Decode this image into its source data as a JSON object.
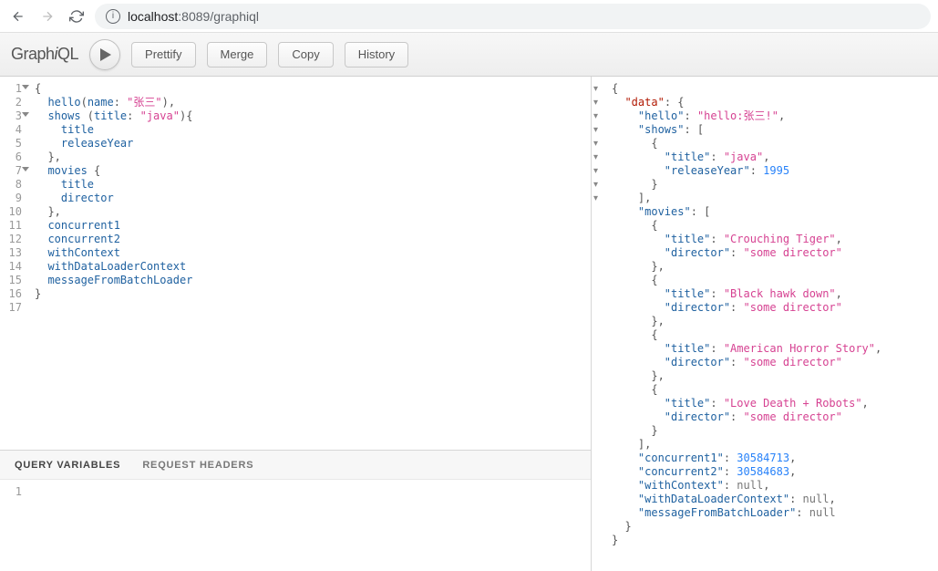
{
  "browser": {
    "url_host": "localhost",
    "url_port": ":8089",
    "url_path": "/graphiql"
  },
  "toolbar": {
    "logo_plain1": "Graph",
    "logo_italic": "i",
    "logo_plain2": "QL",
    "prettify": "Prettify",
    "merge": "Merge",
    "copy": "Copy",
    "history": "History"
  },
  "query_lines": [
    {
      "n": "1",
      "fold": true,
      "tokens": [
        {
          "t": "{",
          "c": "punc"
        }
      ]
    },
    {
      "n": "2",
      "tokens": [
        {
          "t": "  ",
          "c": ""
        },
        {
          "t": "hello",
          "c": "def"
        },
        {
          "t": "(",
          "c": "punc"
        },
        {
          "t": "name",
          "c": "attr"
        },
        {
          "t": ": ",
          "c": "punc"
        },
        {
          "t": "\"张三\"",
          "c": "str"
        },
        {
          "t": "),",
          "c": "punc"
        }
      ]
    },
    {
      "n": "3",
      "fold": true,
      "tokens": [
        {
          "t": "  ",
          "c": ""
        },
        {
          "t": "shows",
          "c": "def"
        },
        {
          "t": " (",
          "c": "punc"
        },
        {
          "t": "title",
          "c": "attr"
        },
        {
          "t": ": ",
          "c": "punc"
        },
        {
          "t": "\"java\"",
          "c": "str"
        },
        {
          "t": "){",
          "c": "punc"
        }
      ]
    },
    {
      "n": "4",
      "tokens": [
        {
          "t": "    ",
          "c": ""
        },
        {
          "t": "title",
          "c": "attr"
        }
      ]
    },
    {
      "n": "5",
      "tokens": [
        {
          "t": "    ",
          "c": ""
        },
        {
          "t": "releaseYear",
          "c": "attr"
        }
      ]
    },
    {
      "n": "6",
      "tokens": [
        {
          "t": "  ",
          "c": ""
        },
        {
          "t": "},",
          "c": "punc"
        }
      ]
    },
    {
      "n": "7",
      "fold": true,
      "tokens": [
        {
          "t": "  ",
          "c": ""
        },
        {
          "t": "movies",
          "c": "def"
        },
        {
          "t": " {",
          "c": "punc"
        }
      ]
    },
    {
      "n": "8",
      "tokens": [
        {
          "t": "    ",
          "c": ""
        },
        {
          "t": "title",
          "c": "attr"
        }
      ]
    },
    {
      "n": "9",
      "tokens": [
        {
          "t": "    ",
          "c": ""
        },
        {
          "t": "director",
          "c": "attr"
        }
      ]
    },
    {
      "n": "10",
      "tokens": [
        {
          "t": "  ",
          "c": ""
        },
        {
          "t": "},",
          "c": "punc"
        }
      ]
    },
    {
      "n": "11",
      "tokens": [
        {
          "t": "  ",
          "c": ""
        },
        {
          "t": "concurrent1",
          "c": "attr"
        }
      ]
    },
    {
      "n": "12",
      "tokens": [
        {
          "t": "  ",
          "c": ""
        },
        {
          "t": "concurrent2",
          "c": "attr"
        }
      ]
    },
    {
      "n": "13",
      "tokens": [
        {
          "t": "  ",
          "c": ""
        },
        {
          "t": "withContext",
          "c": "attr"
        }
      ]
    },
    {
      "n": "14",
      "tokens": [
        {
          "t": "  ",
          "c": ""
        },
        {
          "t": "withDataLoaderContext",
          "c": "attr"
        }
      ]
    },
    {
      "n": "15",
      "tokens": [
        {
          "t": "  ",
          "c": ""
        },
        {
          "t": "messageFromBatchLoader",
          "c": "attr"
        }
      ]
    },
    {
      "n": "16",
      "tokens": [
        {
          "t": "}",
          "c": "punc"
        }
      ]
    },
    {
      "n": "17",
      "tokens": [
        {
          "t": "",
          "c": ""
        }
      ]
    }
  ],
  "tabs": {
    "query_variables": "QUERY VARIABLES",
    "request_headers": "REQUEST HEADERS"
  },
  "vars_lines": [
    {
      "n": "1",
      "tokens": []
    }
  ],
  "result_lines": [
    {
      "fold": true,
      "tokens": [
        {
          "t": "{",
          "c": "punc"
        }
      ]
    },
    {
      "fold": true,
      "tokens": [
        {
          "t": "  ",
          "c": ""
        },
        {
          "t": "\"data\"",
          "c": "keyword"
        },
        {
          "t": ": {",
          "c": "punc"
        }
      ]
    },
    {
      "tokens": [
        {
          "t": "    ",
          "c": ""
        },
        {
          "t": "\"hello\"",
          "c": "key"
        },
        {
          "t": ": ",
          "c": "punc"
        },
        {
          "t": "\"hello:张三!\"",
          "c": "str"
        },
        {
          "t": ",",
          "c": "punc"
        }
      ]
    },
    {
      "fold": true,
      "tokens": [
        {
          "t": "    ",
          "c": ""
        },
        {
          "t": "\"shows\"",
          "c": "key"
        },
        {
          "t": ": [",
          "c": "punc"
        }
      ]
    },
    {
      "fold": true,
      "tokens": [
        {
          "t": "      {",
          "c": "punc"
        }
      ]
    },
    {
      "tokens": [
        {
          "t": "        ",
          "c": ""
        },
        {
          "t": "\"title\"",
          "c": "key"
        },
        {
          "t": ": ",
          "c": "punc"
        },
        {
          "t": "\"java\"",
          "c": "str"
        },
        {
          "t": ",",
          "c": "punc"
        }
      ]
    },
    {
      "tokens": [
        {
          "t": "        ",
          "c": ""
        },
        {
          "t": "\"releaseYear\"",
          "c": "key"
        },
        {
          "t": ": ",
          "c": "punc"
        },
        {
          "t": "1995",
          "c": "num"
        }
      ]
    },
    {
      "tokens": [
        {
          "t": "      }",
          "c": "punc"
        }
      ]
    },
    {
      "tokens": [
        {
          "t": "    ],",
          "c": "punc"
        }
      ]
    },
    {
      "fold": true,
      "tokens": [
        {
          "t": "    ",
          "c": ""
        },
        {
          "t": "\"movies\"",
          "c": "key"
        },
        {
          "t": ": [",
          "c": "punc"
        }
      ]
    },
    {
      "fold": true,
      "tokens": [
        {
          "t": "      {",
          "c": "punc"
        }
      ]
    },
    {
      "tokens": [
        {
          "t": "        ",
          "c": ""
        },
        {
          "t": "\"title\"",
          "c": "key"
        },
        {
          "t": ": ",
          "c": "punc"
        },
        {
          "t": "\"Crouching Tiger\"",
          "c": "str"
        },
        {
          "t": ",",
          "c": "punc"
        }
      ]
    },
    {
      "tokens": [
        {
          "t": "        ",
          "c": ""
        },
        {
          "t": "\"director\"",
          "c": "key"
        },
        {
          "t": ": ",
          "c": "punc"
        },
        {
          "t": "\"some director\"",
          "c": "str"
        }
      ]
    },
    {
      "tokens": [
        {
          "t": "      },",
          "c": "punc"
        }
      ]
    },
    {
      "fold": true,
      "tokens": [
        {
          "t": "      {",
          "c": "punc"
        }
      ]
    },
    {
      "tokens": [
        {
          "t": "        ",
          "c": ""
        },
        {
          "t": "\"title\"",
          "c": "key"
        },
        {
          "t": ": ",
          "c": "punc"
        },
        {
          "t": "\"Black hawk down\"",
          "c": "str"
        },
        {
          "t": ",",
          "c": "punc"
        }
      ]
    },
    {
      "tokens": [
        {
          "t": "        ",
          "c": ""
        },
        {
          "t": "\"director\"",
          "c": "key"
        },
        {
          "t": ": ",
          "c": "punc"
        },
        {
          "t": "\"some director\"",
          "c": "str"
        }
      ]
    },
    {
      "tokens": [
        {
          "t": "      },",
          "c": "punc"
        }
      ]
    },
    {
      "fold": true,
      "tokens": [
        {
          "t": "      {",
          "c": "punc"
        }
      ]
    },
    {
      "tokens": [
        {
          "t": "        ",
          "c": ""
        },
        {
          "t": "\"title\"",
          "c": "key"
        },
        {
          "t": ": ",
          "c": "punc"
        },
        {
          "t": "\"American Horror Story\"",
          "c": "str"
        },
        {
          "t": ",",
          "c": "punc"
        }
      ]
    },
    {
      "tokens": [
        {
          "t": "        ",
          "c": ""
        },
        {
          "t": "\"director\"",
          "c": "key"
        },
        {
          "t": ": ",
          "c": "punc"
        },
        {
          "t": "\"some director\"",
          "c": "str"
        }
      ]
    },
    {
      "tokens": [
        {
          "t": "      },",
          "c": "punc"
        }
      ]
    },
    {
      "fold": true,
      "tokens": [
        {
          "t": "      {",
          "c": "punc"
        }
      ]
    },
    {
      "tokens": [
        {
          "t": "        ",
          "c": ""
        },
        {
          "t": "\"title\"",
          "c": "key"
        },
        {
          "t": ": ",
          "c": "punc"
        },
        {
          "t": "\"Love Death + Robots\"",
          "c": "str"
        },
        {
          "t": ",",
          "c": "punc"
        }
      ]
    },
    {
      "tokens": [
        {
          "t": "        ",
          "c": ""
        },
        {
          "t": "\"director\"",
          "c": "key"
        },
        {
          "t": ": ",
          "c": "punc"
        },
        {
          "t": "\"some director\"",
          "c": "str"
        }
      ]
    },
    {
      "tokens": [
        {
          "t": "      }",
          "c": "punc"
        }
      ]
    },
    {
      "tokens": [
        {
          "t": "    ],",
          "c": "punc"
        }
      ]
    },
    {
      "tokens": [
        {
          "t": "    ",
          "c": ""
        },
        {
          "t": "\"concurrent1\"",
          "c": "key"
        },
        {
          "t": ": ",
          "c": "punc"
        },
        {
          "t": "30584713",
          "c": "num"
        },
        {
          "t": ",",
          "c": "punc"
        }
      ]
    },
    {
      "tokens": [
        {
          "t": "    ",
          "c": ""
        },
        {
          "t": "\"concurrent2\"",
          "c": "key"
        },
        {
          "t": ": ",
          "c": "punc"
        },
        {
          "t": "30584683",
          "c": "num"
        },
        {
          "t": ",",
          "c": "punc"
        }
      ]
    },
    {
      "tokens": [
        {
          "t": "    ",
          "c": ""
        },
        {
          "t": "\"withContext\"",
          "c": "key"
        },
        {
          "t": ": ",
          "c": "punc"
        },
        {
          "t": "null",
          "c": "null"
        },
        {
          "t": ",",
          "c": "punc"
        }
      ]
    },
    {
      "tokens": [
        {
          "t": "    ",
          "c": ""
        },
        {
          "t": "\"withDataLoaderContext\"",
          "c": "key"
        },
        {
          "t": ": ",
          "c": "punc"
        },
        {
          "t": "null",
          "c": "null"
        },
        {
          "t": ",",
          "c": "punc"
        }
      ]
    },
    {
      "tokens": [
        {
          "t": "    ",
          "c": ""
        },
        {
          "t": "\"messageFromBatchLoader\"",
          "c": "key"
        },
        {
          "t": ": ",
          "c": "punc"
        },
        {
          "t": "null",
          "c": "null"
        }
      ]
    },
    {
      "tokens": [
        {
          "t": "  }",
          "c": "punc"
        }
      ]
    },
    {
      "tokens": [
        {
          "t": "}",
          "c": "punc"
        }
      ]
    }
  ]
}
